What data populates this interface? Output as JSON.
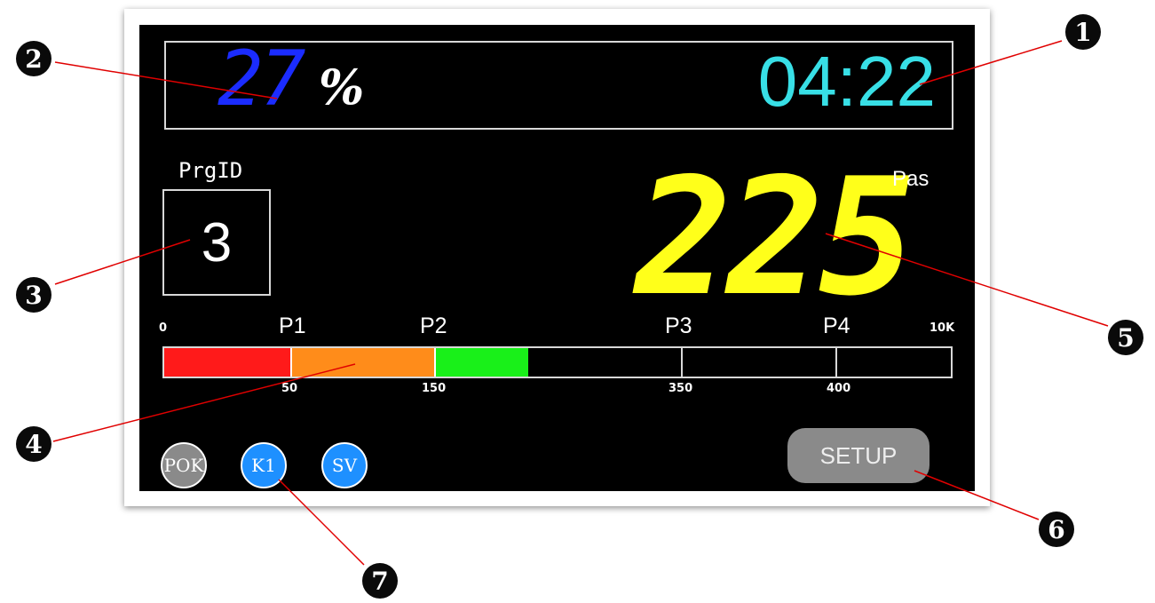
{
  "display": {
    "percent": {
      "value": "27",
      "symbol": "%"
    },
    "time": "04:22",
    "program": {
      "label": "PrgID",
      "value": "3"
    },
    "pressure": {
      "value": "225",
      "unit": "Pas"
    },
    "bar": {
      "scale_min": "0",
      "scale_max": "10K",
      "points": [
        "P1",
        "P2",
        "P3",
        "P4"
      ],
      "values": [
        "50",
        "150",
        "350",
        "400"
      ]
    },
    "indicators": [
      "POK",
      "K1",
      "SV"
    ],
    "setup_label": "SETUP"
  },
  "callouts": [
    "1",
    "2",
    "3",
    "4",
    "5",
    "6",
    "7"
  ],
  "colors": {
    "percent": "#1b2cff",
    "time": "#38dfe6",
    "pressure": "#ffff1a",
    "zone1": "#ff1a1a",
    "zone2": "#ff8c1a",
    "zone3": "#19f019",
    "indicator_off": "#8a8a8a",
    "indicator_on": "#1e90ff",
    "callout_line": "#e00000"
  }
}
